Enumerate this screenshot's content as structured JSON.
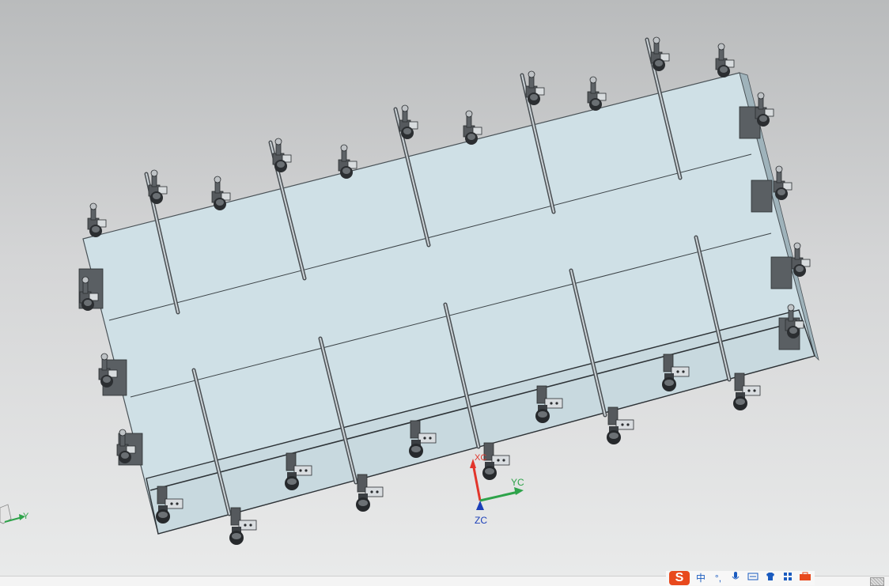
{
  "window": {
    "type": "cad-3d-viewport"
  },
  "axis_triad": {
    "x_label": "XC",
    "y_label": "YC",
    "z_label": "ZC"
  },
  "view_triad": {
    "y_label": "Y"
  },
  "colors": {
    "plate": "#cfe0e6",
    "plate_edge": "#4b5358",
    "clamp": "#4a4e52",
    "x_axis": "#e2352b",
    "y_axis": "#2ea34a",
    "z_axis": "#1b3fb8"
  },
  "taskbar": {
    "ime_logo": "S",
    "ime_buttons": [
      "中",
      "°,",
      "mic-icon",
      "keyboard-icon",
      "shirt-icon",
      "grid-icon",
      "toolbox-icon"
    ]
  },
  "ime_glyphs": {
    "lang": "中",
    "punct": "°,"
  }
}
